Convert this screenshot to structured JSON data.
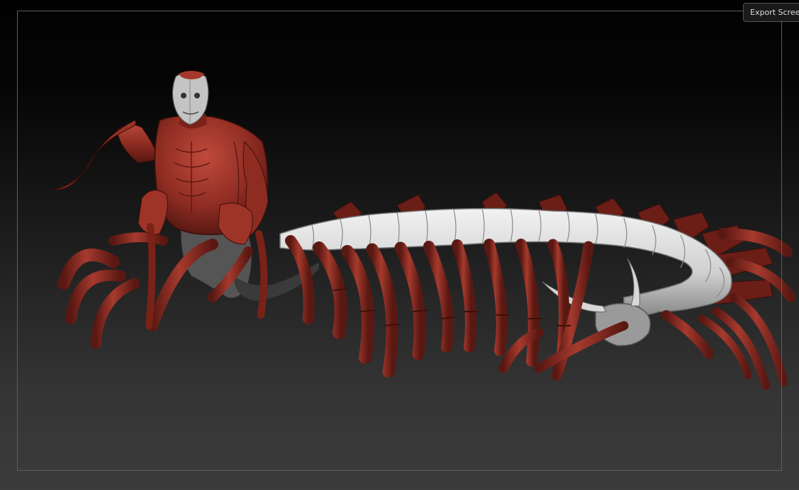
{
  "toolbar": {
    "export_label": "Export Scree"
  },
  "viewport": {
    "subject": "centipede-humanoid-sculpt",
    "colors": {
      "flesh": "#8e2c22",
      "flesh_dark": "#4d1510",
      "flesh_light": "#c8564a",
      "bone": "#e6e6e6",
      "bone_dark": "#8a8a8a",
      "frame": "#5e5e5e"
    }
  }
}
